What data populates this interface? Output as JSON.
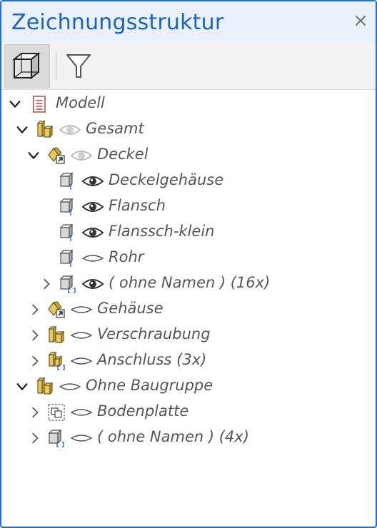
{
  "panel": {
    "title": "Zeichnungsstruktur",
    "close_glyph": "×"
  },
  "toolbar": {
    "buttons": [
      {
        "icon": "model-view-icon",
        "active": true
      },
      {
        "icon": "filter-icon",
        "active": false
      }
    ]
  },
  "tree": {
    "nodes": [
      {
        "label": "Modell",
        "icon": "document-icon",
        "expanded": true
      },
      {
        "label": "Gesamt",
        "icon": "assembly-icon",
        "eye": "visible-dim",
        "expanded": true
      },
      {
        "label": "Deckel",
        "icon": "assembly-link-icon",
        "eye": "visible-dim",
        "expanded": true
      },
      {
        "label": "Deckelgehäuse",
        "icon": "part-icon",
        "eye": "visible"
      },
      {
        "label": "Flansch",
        "icon": "part-icon",
        "eye": "visible"
      },
      {
        "label": "Flanssch-klein",
        "icon": "part-icon",
        "eye": "visible"
      },
      {
        "label": "Rohr",
        "icon": "part-icon",
        "eye": "hidden"
      },
      {
        "label": "( ohne Namen ) (16x)",
        "icon": "part-group-icon",
        "eye": "visible",
        "expanded": false
      },
      {
        "label": "Gehäuse",
        "icon": "assembly-link-icon",
        "eye": "hidden",
        "expanded": false
      },
      {
        "label": "Verschraubung",
        "icon": "assembly-icon",
        "eye": "hidden",
        "expanded": false
      },
      {
        "label": "Anschluss (3x)",
        "icon": "assembly-group-icon",
        "eye": "hidden",
        "expanded": false
      },
      {
        "label": "Ohne Baugruppe",
        "icon": "assembly-icon",
        "eye": "hidden",
        "expanded": true
      },
      {
        "label": "Bodenplatte",
        "icon": "placeholder-part-icon",
        "eye": "hidden",
        "expanded": false
      },
      {
        "label": "( ohne Namen ) (4x)",
        "icon": "part-group-icon",
        "eye": "hidden",
        "expanded": false
      }
    ]
  },
  "colors": {
    "accent": "#1763c9",
    "border": "#1e6fd0",
    "titlebar_bg": "#eaf1fb",
    "label_text": "#555555"
  }
}
